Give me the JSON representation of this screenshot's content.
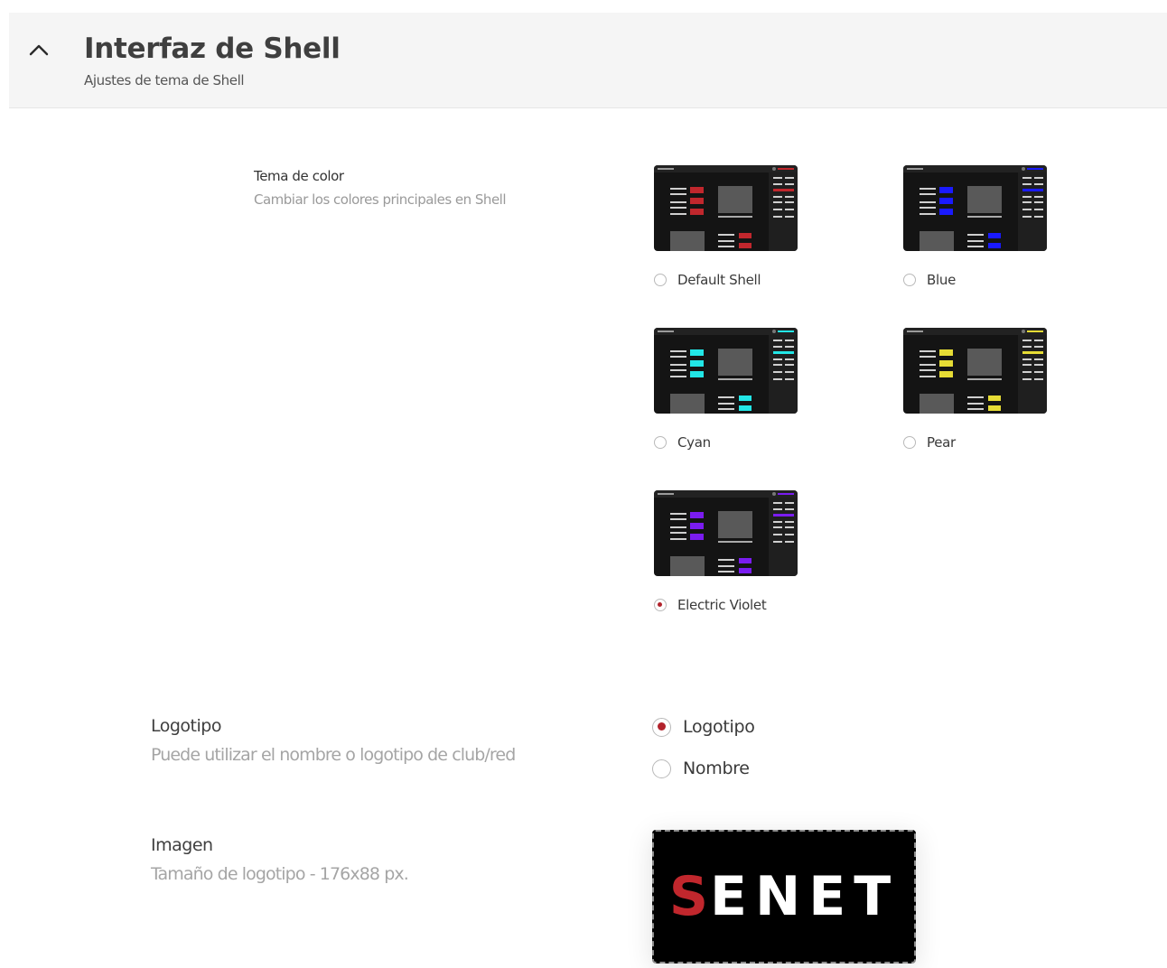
{
  "header": {
    "title": "Interfaz de Shell",
    "subtitle": "Ajustes de tema de Shell"
  },
  "color_theme": {
    "label": "Tema de color",
    "description": "Cambiar los colores principales en Shell",
    "options": [
      {
        "label": "Default Shell",
        "accent": "#c1272d",
        "selected": false
      },
      {
        "label": "Blue",
        "accent": "#1a1aff",
        "selected": false
      },
      {
        "label": "Cyan",
        "accent": "#22e6e6",
        "selected": false
      },
      {
        "label": "Pear",
        "accent": "#e6dc35",
        "selected": false
      },
      {
        "label": "Electric Violet",
        "accent": "#7a1cf0",
        "selected": true
      }
    ]
  },
  "logo": {
    "label": "Logotipo",
    "description": "Puede utilizar el nombre o logotipo de club/red",
    "options": [
      {
        "label": "Logotipo",
        "selected": true
      },
      {
        "label": "Nombre",
        "selected": false
      }
    ]
  },
  "image": {
    "label": "Imagen",
    "description": "Tamaño de logotipo - 176x88 px.",
    "logo_text_accent": "S",
    "logo_text_rest": "ENET"
  },
  "colors": {
    "selected_radio": "#b2232c"
  }
}
